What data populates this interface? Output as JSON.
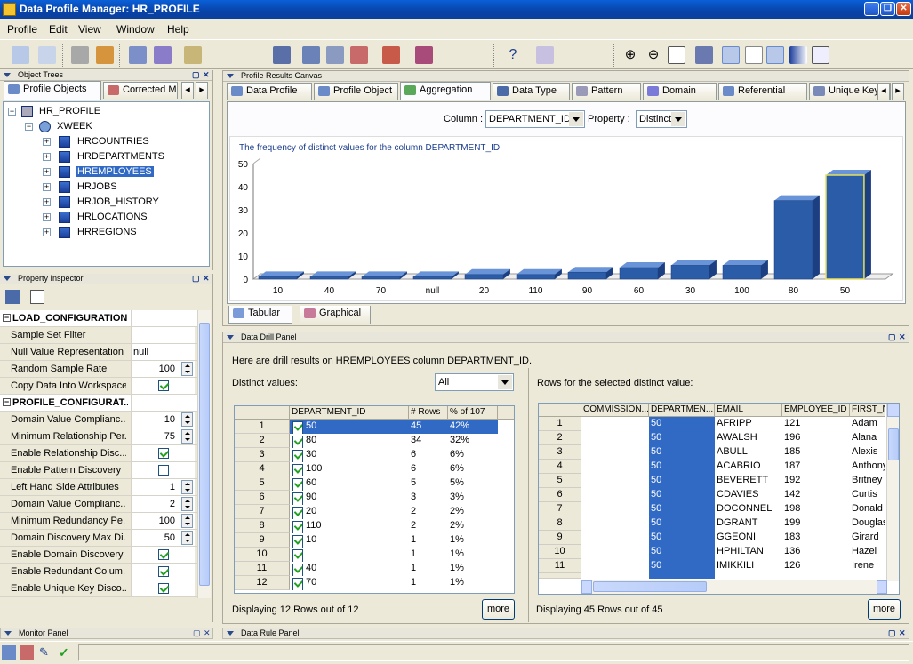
{
  "window": {
    "title": "Data Profile Manager: HR_PROFILE"
  },
  "menu": [
    "Profile",
    "Edit",
    "View",
    "Window",
    "Help"
  ],
  "object_trees": {
    "header": "Object Trees",
    "tabs": [
      "Profile Objects",
      "Corrected M"
    ],
    "root": "HR_PROFILE",
    "module": "XWEEK",
    "tables": [
      "HRCOUNTRIES",
      "HRDEPARTMENTS",
      "HREMPLOYEES",
      "HRJOBS",
      "HRJOB_HISTORY",
      "HRLOCATIONS",
      "HRREGIONS"
    ],
    "selected": "HREMPLOYEES"
  },
  "property_inspector": {
    "header": "Property Inspector",
    "rows": [
      {
        "section": true,
        "label": "LOAD_CONFIGURATION"
      },
      {
        "label": "Sample Set Filter",
        "value": ""
      },
      {
        "label": "Null Value Representation",
        "value": "null"
      },
      {
        "label": "Random Sample Rate",
        "value": "100",
        "spin": true
      },
      {
        "label": "Copy Data Into Workspace",
        "check": true
      },
      {
        "section": true,
        "label": "PROFILE_CONFIGURAT..."
      },
      {
        "label": "Domain Value Complianc...",
        "value": "10",
        "spin": true
      },
      {
        "label": "Minimum Relationship Per...",
        "value": "75",
        "spin": true
      },
      {
        "label": "Enable Relationship Disc...",
        "check": true
      },
      {
        "label": "Enable Pattern Discovery",
        "check": false
      },
      {
        "label": "Left Hand Side Attributes",
        "value": "1",
        "spin": true
      },
      {
        "label": "Domain Value Complianc...",
        "value": "2",
        "spin": true
      },
      {
        "label": "Minimum Redundancy Pe...",
        "value": "100",
        "spin": true
      },
      {
        "label": "Domain Discovery Max Di...",
        "value": "50",
        "spin": true
      },
      {
        "label": "Enable Domain Discovery",
        "check": true
      },
      {
        "label": "Enable Redundant Colum...",
        "check": true
      },
      {
        "label": "Enable Unique Key Disco...",
        "check": true
      }
    ]
  },
  "canvas": {
    "header": "Profile Results Canvas",
    "tabs": [
      "Data Profile",
      "Profile Object",
      "Aggregation",
      "Data Type",
      "Pattern",
      "Domain",
      "Referential",
      "Unique Key"
    ],
    "active_tab": "Aggregation",
    "column_label": "Column :",
    "column_value": "DEPARTMENT_ID",
    "property_label": "Property :",
    "property_value": "Distinct",
    "bottom_tabs": [
      "Tabular",
      "Graphical"
    ]
  },
  "chart_data": {
    "type": "bar",
    "title": "The frequency of distinct values for the column DEPARTMENT_ID",
    "categories": [
      "10",
      "40",
      "70",
      "null",
      "20",
      "110",
      "90",
      "60",
      "30",
      "100",
      "80",
      "50"
    ],
    "values": [
      1,
      1,
      1,
      1,
      2,
      2,
      3,
      5,
      6,
      6,
      34,
      45
    ],
    "ylim": [
      0,
      50
    ],
    "yticks": [
      "0",
      "10",
      "20",
      "30",
      "40",
      "50"
    ],
    "bar_color": "#2a5ca8",
    "highlight_color": "#e8e05a"
  },
  "drill": {
    "header": "Data Drill Panel",
    "intro": "Here are drill results on HREMPLOYEES column DEPARTMENT_ID.",
    "distinct_label": "Distinct values:",
    "filter": "All",
    "rows_label": "Rows for the selected distinct value:",
    "left_headers": [
      "DEPARTMENT_ID",
      "# Rows",
      "% of 107"
    ],
    "left_rows": [
      [
        "1",
        "50",
        "45",
        "42%"
      ],
      [
        "2",
        "80",
        "34",
        "32%"
      ],
      [
        "3",
        "30",
        "6",
        "6%"
      ],
      [
        "4",
        "100",
        "6",
        "6%"
      ],
      [
        "5",
        "60",
        "5",
        "5%"
      ],
      [
        "6",
        "90",
        "3",
        "3%"
      ],
      [
        "7",
        "20",
        "2",
        "2%"
      ],
      [
        "8",
        "110",
        "2",
        "2%"
      ],
      [
        "9",
        "10",
        "1",
        "1%"
      ],
      [
        "10",
        "",
        "1",
        "1%"
      ],
      [
        "11",
        "40",
        "1",
        "1%"
      ],
      [
        "12",
        "70",
        "1",
        "1%"
      ]
    ],
    "right_headers": [
      "COMMISSION...",
      "DEPARTMEN...",
      "EMAIL",
      "EMPLOYEE_ID",
      "FIRST_N"
    ],
    "right_rows": [
      [
        "1",
        "",
        "50",
        "AFRIPP",
        "121",
        "Adam"
      ],
      [
        "2",
        "",
        "50",
        "AWALSH",
        "196",
        "Alana"
      ],
      [
        "3",
        "",
        "50",
        "ABULL",
        "185",
        "Alexis"
      ],
      [
        "4",
        "",
        "50",
        "ACABRIO",
        "187",
        "Anthony"
      ],
      [
        "5",
        "",
        "50",
        "BEVERETT",
        "192",
        "Britney"
      ],
      [
        "6",
        "",
        "50",
        "CDAVIES",
        "142",
        "Curtis"
      ],
      [
        "7",
        "",
        "50",
        "DOCONNEL",
        "198",
        "Donald"
      ],
      [
        "8",
        "",
        "50",
        "DGRANT",
        "199",
        "Douglas"
      ],
      [
        "9",
        "",
        "50",
        "GGEONI",
        "183",
        "Girard"
      ],
      [
        "10",
        "",
        "50",
        "HPHILTAN",
        "136",
        "Hazel"
      ],
      [
        "11",
        "",
        "50",
        "IMIKKILI",
        "126",
        "Irene"
      ]
    ],
    "left_status": "Displaying 12 Rows out of 12",
    "right_status": "Displaying 45 Rows out of 45",
    "more": "more"
  },
  "monitor_panel": "Monitor Panel",
  "rule_panel": "Data Rule Panel"
}
